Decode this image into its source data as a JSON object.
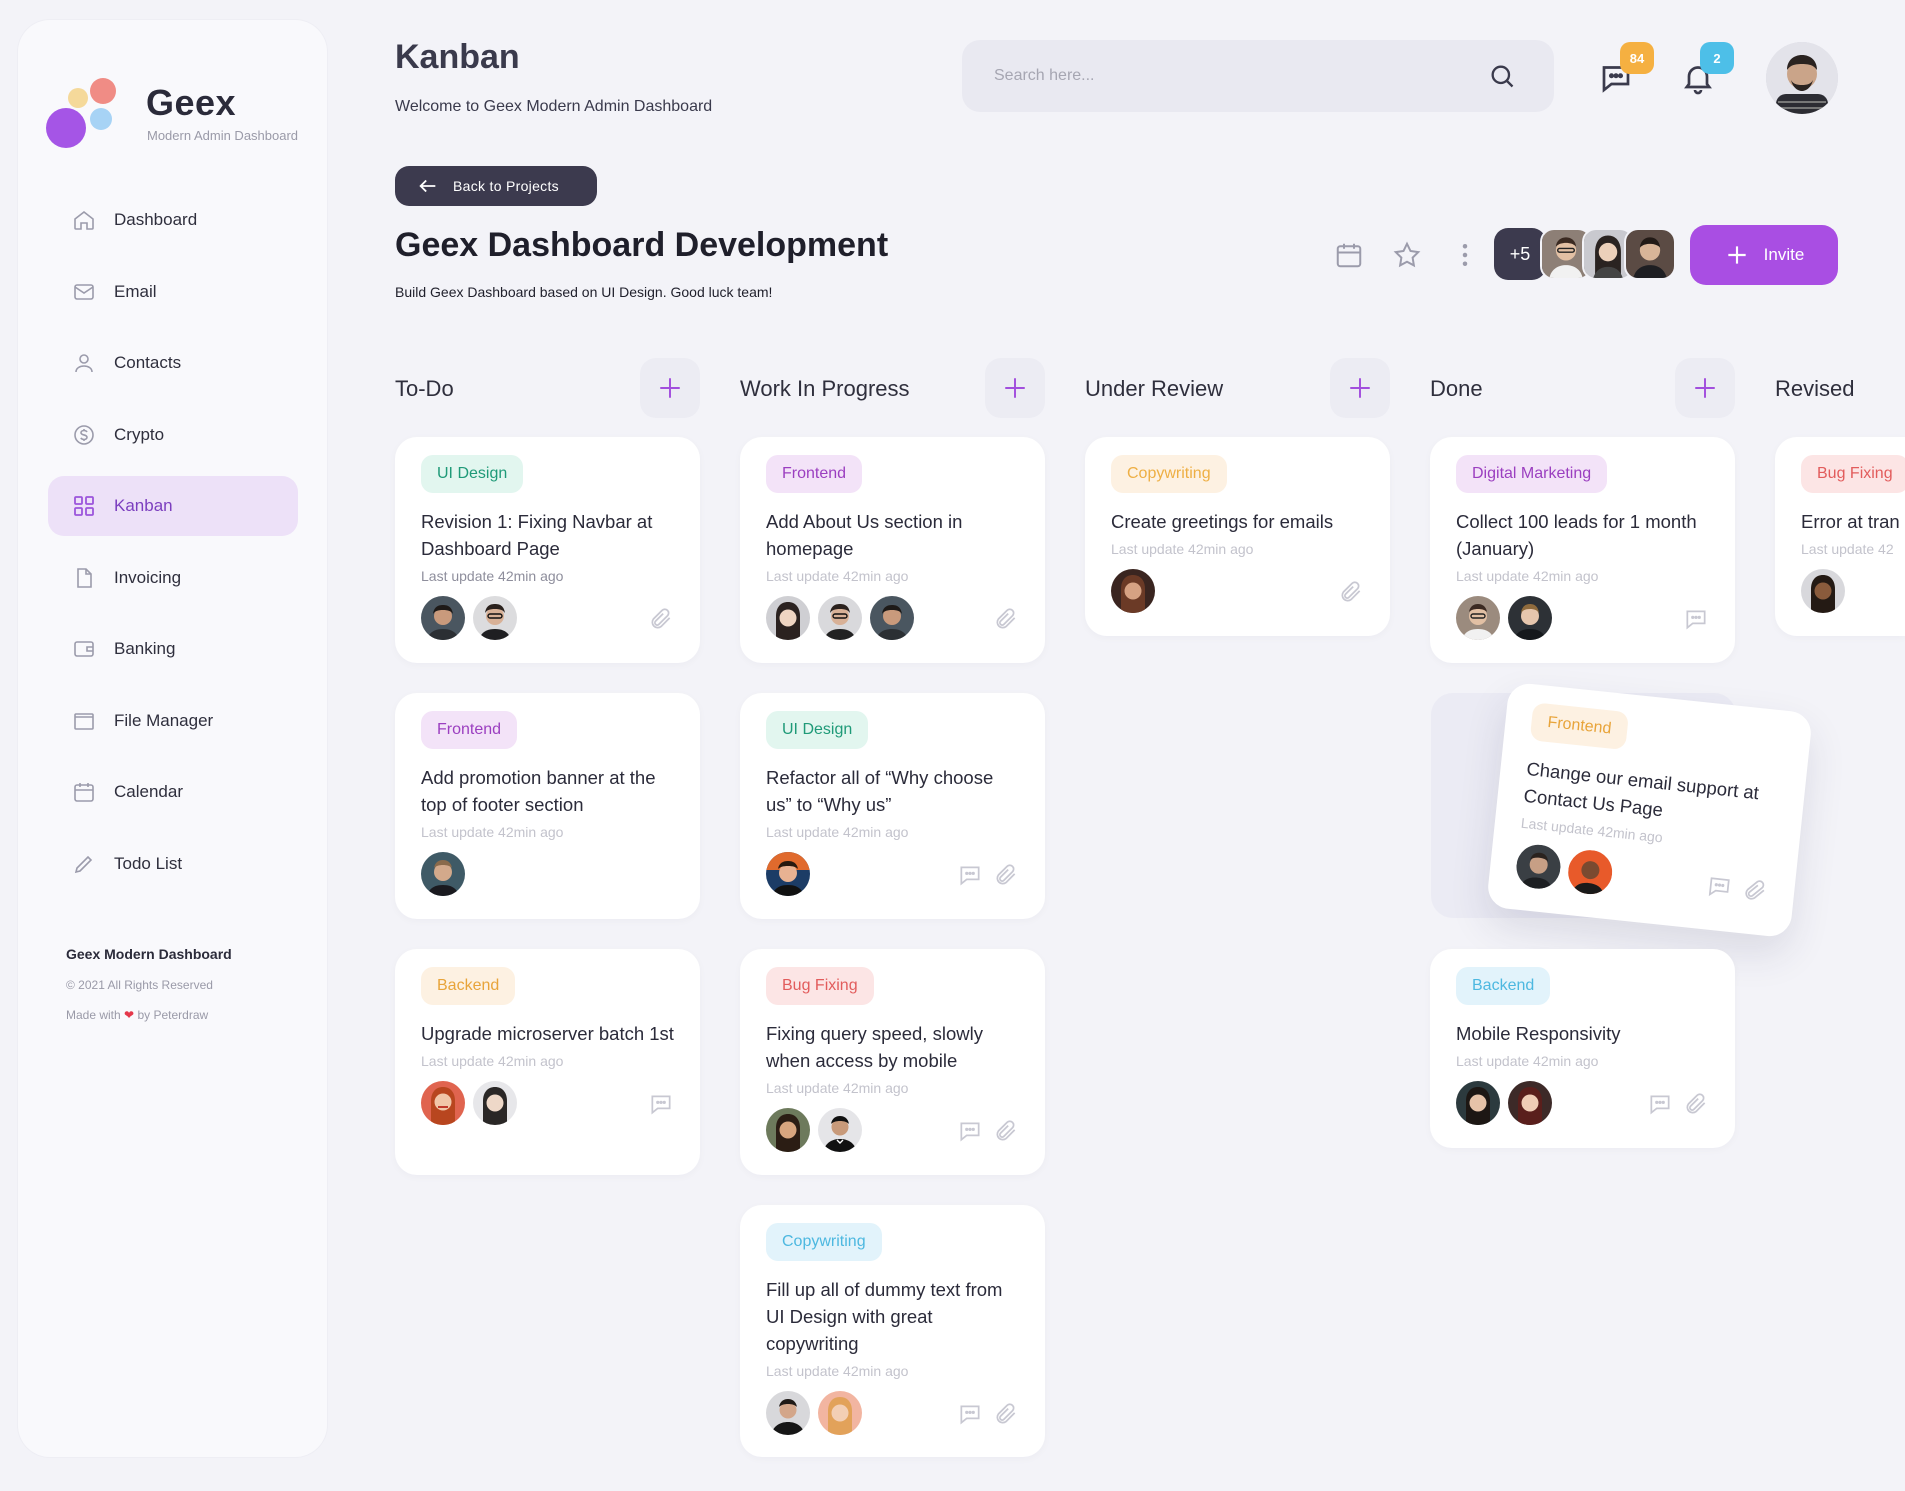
{
  "brand": {
    "name": "Geex",
    "tagline": "Modern Admin Dashboard"
  },
  "sidebar": {
    "items": [
      {
        "label": "Dashboard",
        "icon": "home-icon",
        "active": false
      },
      {
        "label": "Email",
        "icon": "mail-icon",
        "active": false
      },
      {
        "label": "Contacts",
        "icon": "user-icon",
        "active": false
      },
      {
        "label": "Crypto",
        "icon": "dollar-coin-icon",
        "active": false
      },
      {
        "label": "Kanban",
        "icon": "grid-icon",
        "active": true
      },
      {
        "label": "Invoicing",
        "icon": "file-icon",
        "active": false
      },
      {
        "label": "Banking",
        "icon": "wallet-icon",
        "active": false
      },
      {
        "label": "File Manager",
        "icon": "folder-icon",
        "active": false
      },
      {
        "label": "Calendar",
        "icon": "calendar-icon",
        "active": false
      },
      {
        "label": "Todo List",
        "icon": "pencil-icon",
        "active": false
      }
    ],
    "footer": {
      "title": "Geex Modern Dashboard",
      "copyright": "© 2021 All Rights Reserved",
      "made_prefix": "Made with",
      "made_suffix": "by Peterdraw"
    }
  },
  "header": {
    "title": "Kanban",
    "subtitle": "Welcome to Geex Modern Admin Dashboard",
    "search_placeholder": "Search here...",
    "messages_count": "84",
    "notifications_count": "2"
  },
  "project": {
    "back_label": "Back to Projects",
    "title": "Geex Dashboard Development",
    "subtitle": "Build Geex Dashboard based on UI Design. Good luck team!",
    "more_members": "+5",
    "invite_label": "Invite"
  },
  "columns": [
    {
      "title": "To-Do"
    },
    {
      "title": "Work In Progress"
    },
    {
      "title": "Under Review"
    },
    {
      "title": "Done"
    },
    {
      "title": "Revised"
    }
  ],
  "cards": [
    {
      "tag": "UI Design",
      "title": "Revision 1: Fixing Navbar at Dashboard Page",
      "updated": "Last update 42min ago"
    },
    {
      "tag": "Frontend",
      "title": "Add promotion banner at the top of footer section",
      "updated": "Last update 42min ago"
    },
    {
      "tag": "Backend",
      "title": "Upgrade microserver batch 1st",
      "updated": "Last update 42min ago"
    },
    {
      "tag": "Frontend",
      "title": "Add About Us section in homepage",
      "updated": "Last update 42min ago"
    },
    {
      "tag": "UI Design",
      "title": "Refactor all of “Why choose us” to “Why us”",
      "updated": "Last update 42min ago"
    },
    {
      "tag": "Bug Fixing",
      "title": "Fixing query speed, slowly when access by mobile",
      "updated": "Last update 42min ago"
    },
    {
      "tag": "Copywriting",
      "title": "Fill up all of dummy text from UI Design with great copywriting",
      "updated": "Last update 42min ago"
    },
    {
      "tag": "Copywriting",
      "title": "Create greetings for emails",
      "updated": "Last update 42min ago"
    },
    {
      "tag": "Digital Marketing",
      "title": "Collect 100 leads for 1 month (January)",
      "updated": "Last update 42min ago"
    },
    {
      "tag": "Frontend",
      "title": "Change our email support at Contact Us Page",
      "updated": "Last update 42min ago"
    },
    {
      "tag": "Backend",
      "title": "Mobile Responsivity",
      "updated": "Last update 42min ago"
    },
    {
      "tag": "Bug Fixing",
      "title": "Error at tran",
      "updated": "Last update 42"
    }
  ],
  "colors": {
    "accent": "#a94ee3",
    "dark": "#3c3a4e",
    "background": "#f3f3f8",
    "messages_badge": "#f5b041",
    "notifications_badge": "#4dbfe8"
  }
}
